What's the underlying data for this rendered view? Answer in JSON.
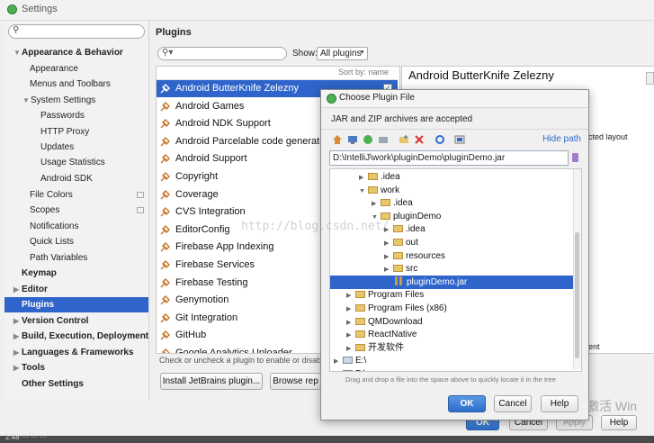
{
  "window": {
    "title": "Settings"
  },
  "sidebar": {
    "search_placeholder": "",
    "items": [
      {
        "label": "Appearance & Behavior",
        "bold": true,
        "expanded": true
      },
      {
        "label": "Appearance"
      },
      {
        "label": "Menus and Toolbars"
      },
      {
        "label": "System Settings",
        "expanded": true
      },
      {
        "label": "Passwords"
      },
      {
        "label": "HTTP Proxy"
      },
      {
        "label": "Updates"
      },
      {
        "label": "Usage Statistics"
      },
      {
        "label": "Android SDK"
      },
      {
        "label": "File Colors"
      },
      {
        "label": "Scopes"
      },
      {
        "label": "Notifications"
      },
      {
        "label": "Quick Lists"
      },
      {
        "label": "Path Variables"
      },
      {
        "label": "Keymap",
        "bold": true
      },
      {
        "label": "Editor",
        "bold": true
      },
      {
        "label": "Plugins",
        "bold": true,
        "selected": true
      },
      {
        "label": "Version Control",
        "bold": true
      },
      {
        "label": "Build, Execution, Deployment",
        "bold": true
      },
      {
        "label": "Languages & Frameworks",
        "bold": true
      },
      {
        "label": "Tools",
        "bold": true
      },
      {
        "label": "Other Settings",
        "bold": true
      }
    ]
  },
  "plugins": {
    "title": "Plugins",
    "search_value": "",
    "show_label": "Show:",
    "show_selected": "All plugins",
    "sort_label": "Sort by: name",
    "list": [
      {
        "name": "Android ButterKnife Zelezny",
        "selected": true,
        "checked": true
      },
      {
        "name": "Android Games"
      },
      {
        "name": "Android NDK Support"
      },
      {
        "name": "Android Parcelable code generator"
      },
      {
        "name": "Android Support"
      },
      {
        "name": "Copyright"
      },
      {
        "name": "Coverage"
      },
      {
        "name": "CVS Integration"
      },
      {
        "name": "EditorConfig"
      },
      {
        "name": "Firebase App Indexing"
      },
      {
        "name": "Firebase Services"
      },
      {
        "name": "Firebase Testing"
      },
      {
        "name": "Genymotion"
      },
      {
        "name": "Git Integration"
      },
      {
        "name": "GitHub"
      },
      {
        "name": "Google Analytics Uploader"
      }
    ],
    "hint": "Check or uncheck a plugin to enable or disable it.",
    "install_button": "Install JetBrains plugin...",
    "browse_button": "Browse rep",
    "detail_title": "Android ButterKnife Zelezny",
    "detail_fragment_1": "cted layout",
    "detail_fragment_2": "ent"
  },
  "settings_buttons": {
    "ok": "OK",
    "cancel": "Cancel",
    "apply": "Apply",
    "help": "Help"
  },
  "dialog": {
    "title": "Choose Plugin File",
    "subtitle": "JAR and ZIP archives are accepted",
    "hide_path": "Hide path",
    "path": "D:\\IntelliJ\\work\\pluginDemo\\pluginDemo.jar",
    "tree": [
      {
        "label": ".idea",
        "depth": 2,
        "type": "folder",
        "collapsed": true
      },
      {
        "label": "work",
        "depth": 2,
        "type": "folder",
        "expanded": true
      },
      {
        "label": ".idea",
        "depth": 3,
        "type": "folder",
        "collapsed": true
      },
      {
        "label": "pluginDemo",
        "depth": 3,
        "type": "folder",
        "expanded": true
      },
      {
        "label": ".idea",
        "depth": 4,
        "type": "folder",
        "collapsed": true
      },
      {
        "label": "out",
        "depth": 4,
        "type": "folder",
        "collapsed": true
      },
      {
        "label": "resources",
        "depth": 4,
        "type": "folder",
        "collapsed": true
      },
      {
        "label": "src",
        "depth": 4,
        "type": "folder",
        "collapsed": true
      },
      {
        "label": "pluginDemo.jar",
        "depth": 4,
        "type": "jar",
        "selected": true
      },
      {
        "label": "Program Files",
        "depth": 1,
        "type": "folder",
        "collapsed": true
      },
      {
        "label": "Program Files (x86)",
        "depth": 1,
        "type": "folder",
        "collapsed": true
      },
      {
        "label": "QMDownload",
        "depth": 1,
        "type": "folder",
        "collapsed": true
      },
      {
        "label": "ReactNative",
        "depth": 1,
        "type": "folder",
        "collapsed": true
      },
      {
        "label": "开发软件",
        "depth": 1,
        "type": "folder",
        "collapsed": true
      },
      {
        "label": "E:\\",
        "depth": 0,
        "type": "drive",
        "collapsed": true
      },
      {
        "label": "F:\\",
        "depth": 0,
        "type": "drive",
        "collapsed": true
      }
    ],
    "drop_hint": "Drag and drop a file into the space above to quickly locate it in the tree",
    "ok": "OK",
    "cancel": "Cancel",
    "help": "Help"
  },
  "watermark": "http://blog.csdn.net/",
  "os_overlay": "激活 Win",
  "status_fragment": "2.48 ··· ··· ···"
}
